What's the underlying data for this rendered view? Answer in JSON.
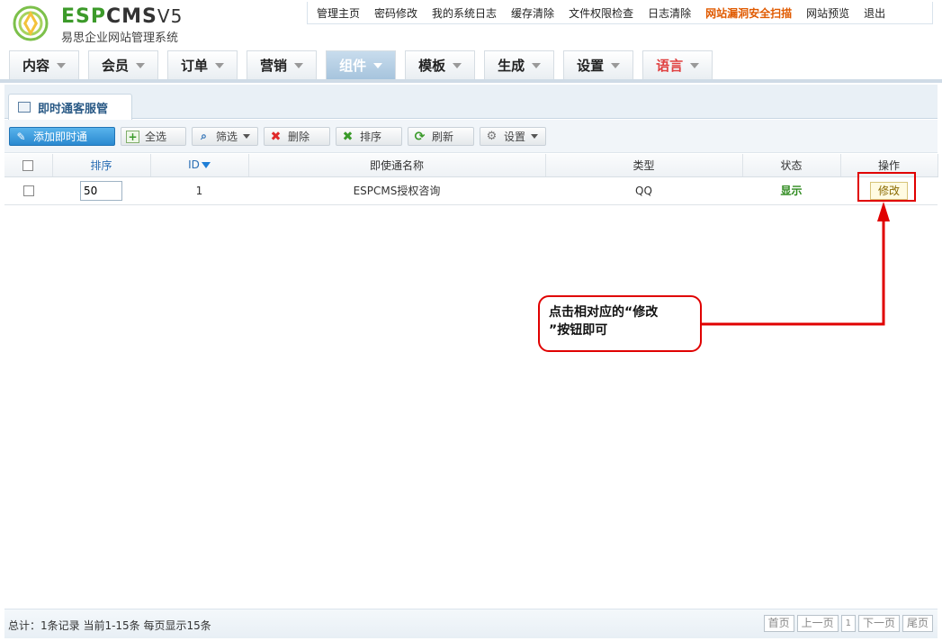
{
  "logo": {
    "brand_esp": "ESP",
    "brand_cms": "CMS",
    "brand_ver": "V5",
    "subtitle": "易思企业网站管理系统"
  },
  "topnav": [
    {
      "label": "管理主页",
      "hot": false
    },
    {
      "label": "密码修改",
      "hot": false
    },
    {
      "label": "我的系统日志",
      "hot": false
    },
    {
      "label": "缓存清除",
      "hot": false
    },
    {
      "label": "文件权限检查",
      "hot": false
    },
    {
      "label": "日志清除",
      "hot": false
    },
    {
      "label": "网站漏洞安全扫描",
      "hot": true
    },
    {
      "label": "网站预览",
      "hot": false
    },
    {
      "label": "退出",
      "hot": false
    }
  ],
  "mainmenu": [
    {
      "label": "内容"
    },
    {
      "label": "会员"
    },
    {
      "label": "订单"
    },
    {
      "label": "营销"
    },
    {
      "label": "组件",
      "active": true
    },
    {
      "label": "模板"
    },
    {
      "label": "生成"
    },
    {
      "label": "设置"
    },
    {
      "label": "语言",
      "lang": true
    }
  ],
  "panel": {
    "tab_label": "即时通客服管"
  },
  "toolbar": {
    "add": "添加即时通",
    "select_all": "全选",
    "filter": "筛选",
    "delete": "删除",
    "sort": "排序",
    "refresh": "刷新",
    "settings": "设置"
  },
  "table": {
    "headers": {
      "sort": "排序",
      "id": "ID",
      "name": "即使通名称",
      "type": "类型",
      "state": "状态",
      "action": "操作"
    },
    "rows": [
      {
        "sort": "50",
        "id": "1",
        "name": "ESPCMS授权咨询",
        "type": "QQ",
        "state": "显示",
        "action": "修改"
      }
    ]
  },
  "annotation": {
    "line1": "点击相对应的“修改",
    "line2": "”按钮即可",
    "color": "#e00000"
  },
  "footer": {
    "info": "总计：1条记录 当前1-15条 每页显示15条",
    "first": "首页",
    "prev": "上一页",
    "page": "1",
    "next": "下一页",
    "last": "尾页"
  },
  "colors": {
    "accent": "#2a89d0",
    "active_menu": "#a6c4dd",
    "state_green": "#2e8a1e",
    "hot_link": "#e05a00"
  }
}
